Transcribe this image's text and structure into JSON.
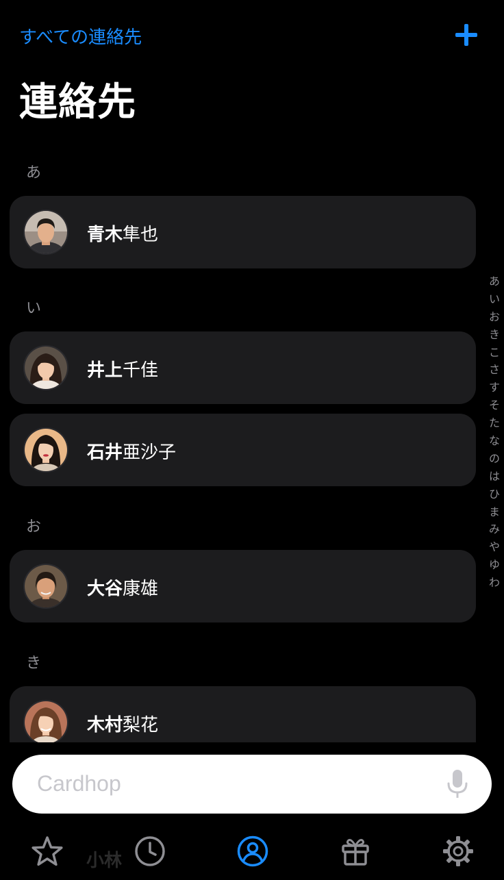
{
  "header": {
    "back_label": "すべての連絡先",
    "add_icon": "plus-icon",
    "title": "連絡先"
  },
  "sections": [
    {
      "letter": "あ",
      "contacts": [
        {
          "family": "青木",
          "given": "隼也"
        }
      ]
    },
    {
      "letter": "い",
      "contacts": [
        {
          "family": "井上",
          "given": "千佳"
        },
        {
          "family": "石井",
          "given": "亜沙子"
        }
      ]
    },
    {
      "letter": "お",
      "contacts": [
        {
          "family": "大谷",
          "given": "康雄"
        }
      ]
    },
    {
      "letter": "き",
      "contacts": [
        {
          "family": "木村",
          "given": "梨花"
        }
      ]
    }
  ],
  "index_bar": [
    "あ",
    "い",
    "お",
    "き",
    "こ",
    "さ",
    "す",
    "そ",
    "た",
    "な",
    "の",
    "は",
    "ひ",
    "ま",
    "み",
    "や",
    "ゆ",
    "わ"
  ],
  "search": {
    "placeholder": "Cardhop",
    "mic_icon": "microphone-icon"
  },
  "tabbar": {
    "ghost_label": "小林",
    "tabs": [
      {
        "icon": "star-icon"
      },
      {
        "icon": "clock-icon"
      },
      {
        "icon": "person-circle-icon",
        "active": true
      },
      {
        "icon": "gift-icon"
      },
      {
        "icon": "gear-icon"
      }
    ]
  },
  "colors": {
    "accent": "#1a8cff",
    "background": "#000000",
    "card": "#1c1c1e",
    "secondary_text": "#8e8e93",
    "inactive_tab": "#8e8e93"
  }
}
